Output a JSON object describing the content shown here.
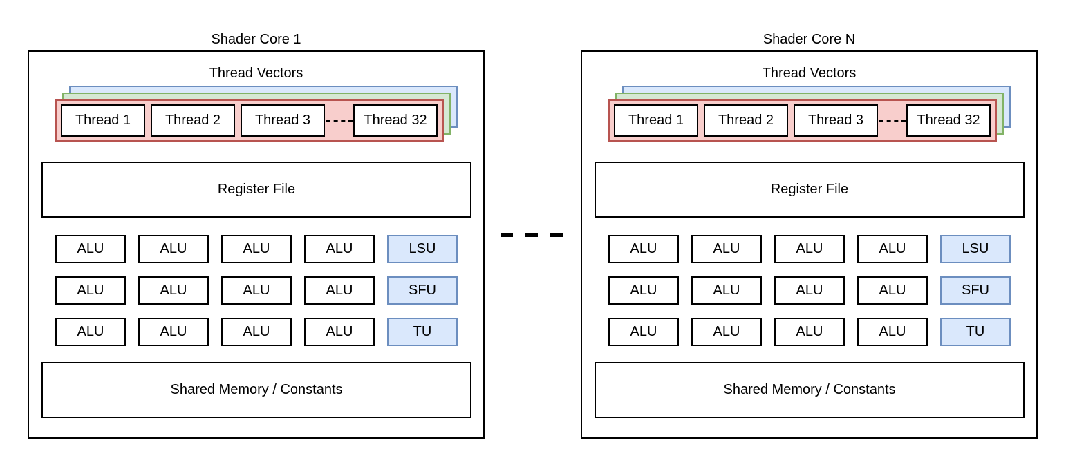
{
  "cores": [
    {
      "title": "Shader Core 1",
      "thread_vectors_label": "Thread Vectors",
      "threads": [
        "Thread 1",
        "Thread 2",
        "Thread 3",
        "Thread 32"
      ],
      "register_file": "Register File",
      "unit_rows": [
        [
          "ALU",
          "ALU",
          "ALU",
          "ALU",
          "LSU"
        ],
        [
          "ALU",
          "ALU",
          "ALU",
          "ALU",
          "SFU"
        ],
        [
          "ALU",
          "ALU",
          "ALU",
          "ALU",
          "TU"
        ]
      ],
      "shared_memory": "Shared Memory / Constants"
    },
    {
      "title": "Shader Core N",
      "thread_vectors_label": "Thread Vectors",
      "threads": [
        "Thread 1",
        "Thread 2",
        "Thread 3",
        "Thread 32"
      ],
      "register_file": "Register File",
      "unit_rows": [
        [
          "ALU",
          "ALU",
          "ALU",
          "ALU",
          "LSU"
        ],
        [
          "ALU",
          "ALU",
          "ALU",
          "ALU",
          "SFU"
        ],
        [
          "ALU",
          "ALU",
          "ALU",
          "ALU",
          "TU"
        ]
      ],
      "shared_memory": "Shared Memory / Constants"
    }
  ],
  "colors": {
    "vector_blue": "#dae8fc",
    "vector_green": "#d5e8d4",
    "vector_red": "#f8cecc",
    "special_unit": "#dae8fc"
  }
}
